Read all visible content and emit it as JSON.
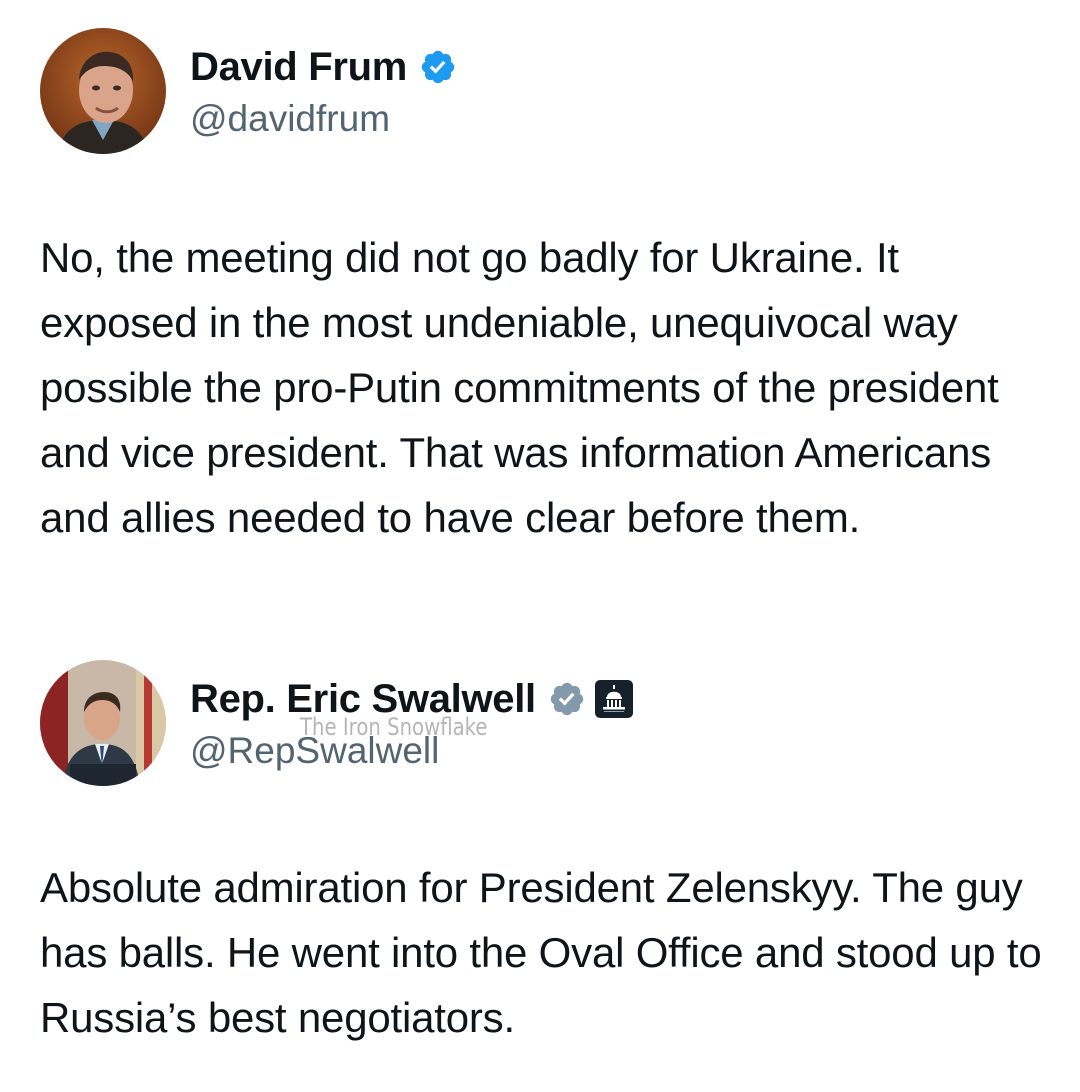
{
  "tweets": [
    {
      "author": {
        "display_name": "David Frum",
        "handle": "@davidfrum",
        "verified": true,
        "avatar_icon": "person-avatar"
      },
      "text": "No, the meeting did not go badly for Ukraine. It exposed in the most undeniable, unequivocal way possible the pro-Putin commitments of the president and vice president. That was information Americans and allies needed to have clear before them."
    },
    {
      "author": {
        "display_name": "Rep. Eric Swalwell",
        "handle": "@RepSwalwell",
        "verified": true,
        "verified_style": "government-gray",
        "affiliation_badge_icon": "capitol-building-icon",
        "avatar_icon": "person-at-podium-avatar"
      },
      "text": "Absolute admiration for President Zelenskyy. The guy has balls. He went into the Oval Office and stood up to Russia’s best negotiators."
    }
  ],
  "watermark": "The Iron Snowflake",
  "colors": {
    "text": "#0f1419",
    "handle": "#536471",
    "verified_blue": "#1d9bf0",
    "verified_gray": "#829aab",
    "background": "#ffffff"
  }
}
